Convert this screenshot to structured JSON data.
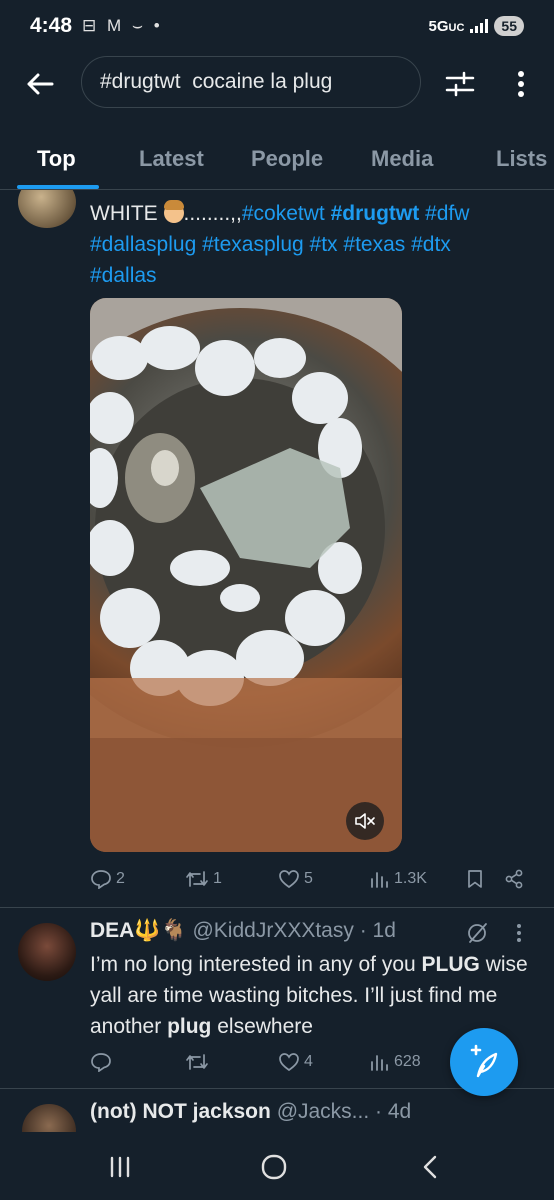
{
  "status_bar": {
    "time": "4:48",
    "left_icons": "⊟ M ⌣ •",
    "network": "5G",
    "network_sub": "UC",
    "battery": "55"
  },
  "search": {
    "query": "#drugtwt  cocaine la plug"
  },
  "tabs": [
    {
      "label": "Top",
      "active": true
    },
    {
      "label": "Latest",
      "active": false
    },
    {
      "label": "People",
      "active": false
    },
    {
      "label": "Media",
      "active": false
    },
    {
      "label": "Lists",
      "active": false
    }
  ],
  "tweet1": {
    "text_prefix": "WHITE ",
    "dots": "........,,",
    "hashtags_line1": [
      "#coketwt",
      "#drugtwt",
      "#dfw"
    ],
    "hashtags_line2": [
      "#dallasplug",
      "#texasplug",
      "#tx",
      "#texas",
      "#dtx"
    ],
    "hashtags_line3": [
      "#dallas"
    ],
    "actions": {
      "replies": "2",
      "retweets": "1",
      "likes": "5",
      "views": "1.3K"
    }
  },
  "tweet2": {
    "name": "DEA",
    "name_emoji": "🔱🐐",
    "handle": "@KiddJrXXXtasy",
    "time": "· 1d",
    "body_part1": "I’m no long interested in any of you ",
    "body_bold1": "PLUG",
    "body_part2": " wise yall are time wasting bitches. I’ll just find me another ",
    "body_bold2": "plug",
    "body_part3": " elsewhere",
    "actions": {
      "replies": "",
      "retweets": "",
      "likes": "4",
      "views": "628"
    }
  },
  "tweet3": {
    "name": "(not) NOT jackson",
    "handle": "@Jacks...",
    "time": "· 4d"
  },
  "colors": {
    "background": "#15202b",
    "accent": "#1d9bf0",
    "muted": "#8b98a5",
    "text": "#e7e9ea"
  }
}
